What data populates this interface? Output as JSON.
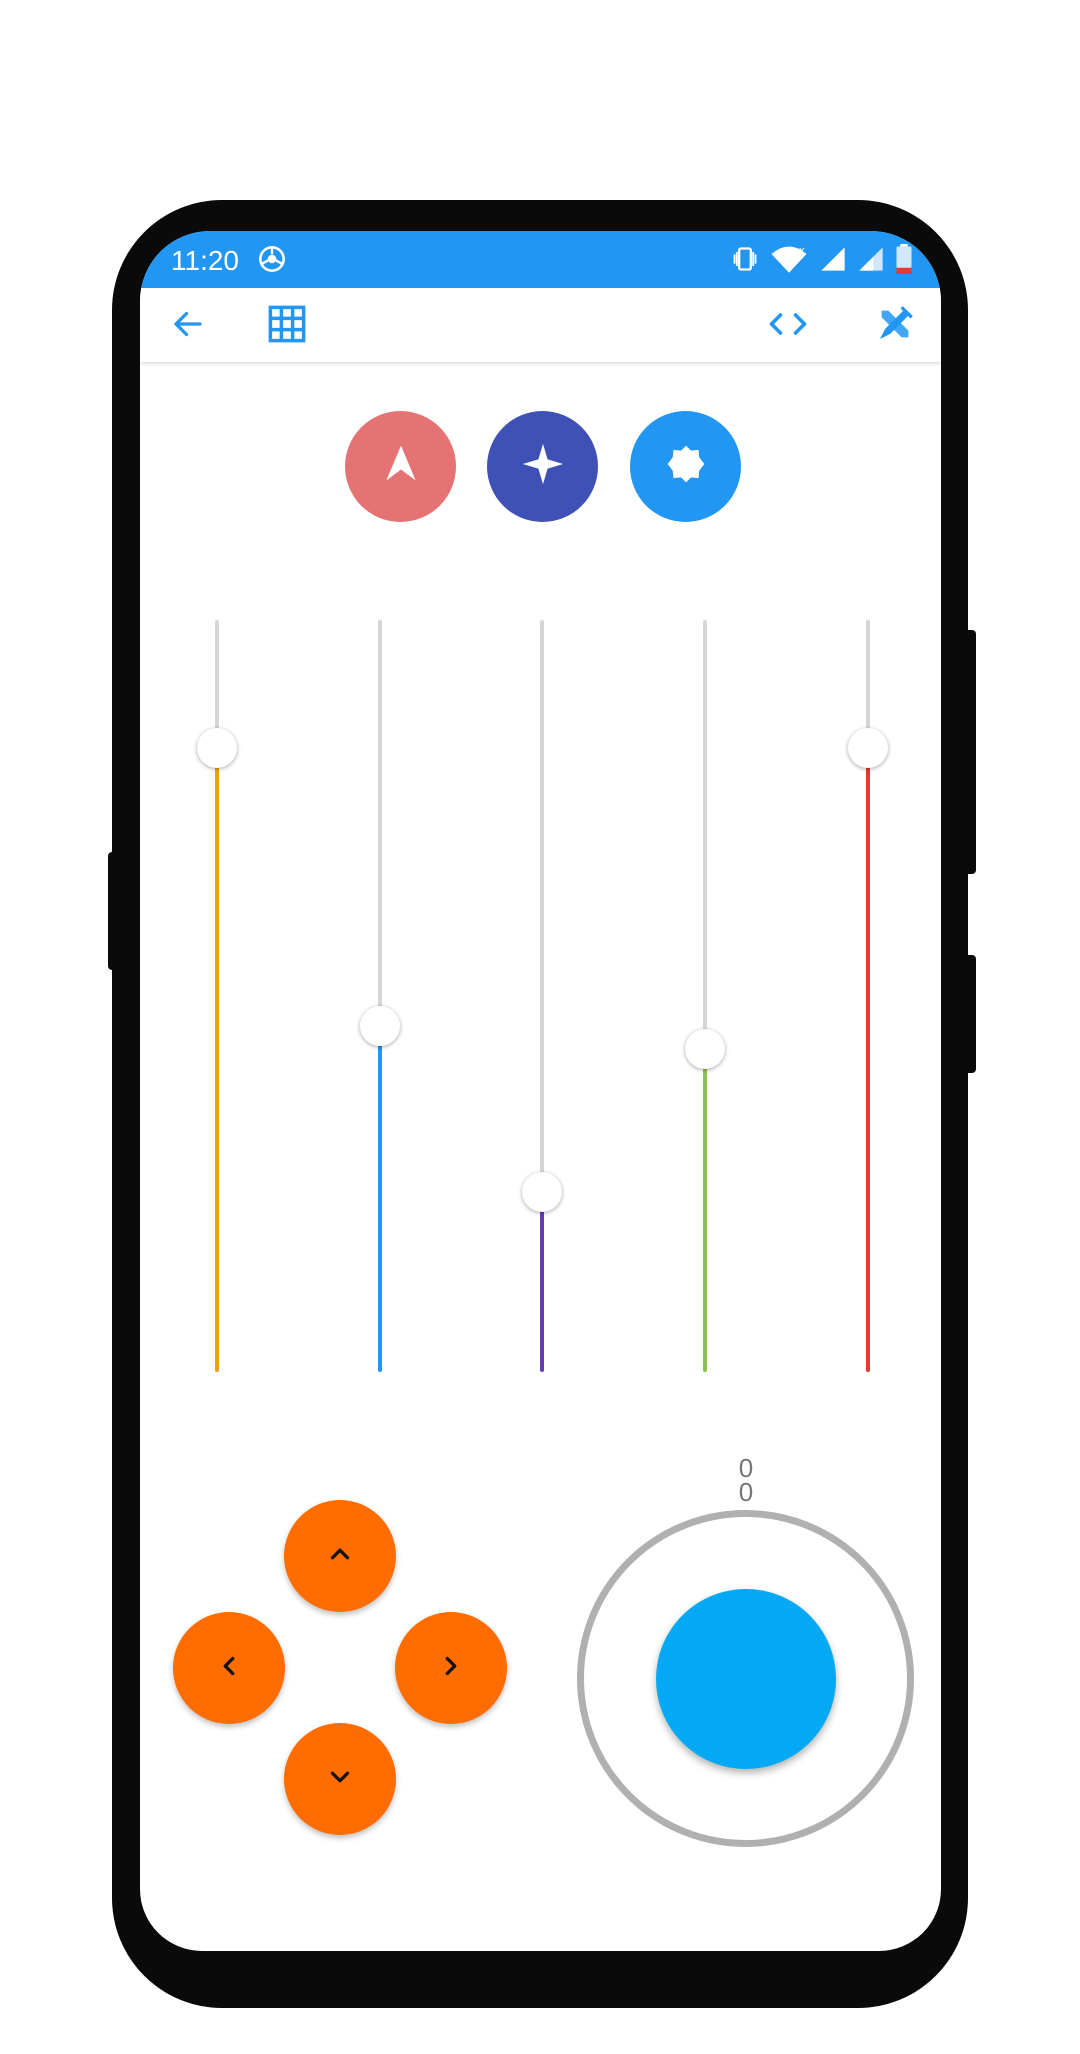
{
  "status_bar": {
    "time": "11:20",
    "icons": [
      "chrome-icon",
      "vibrate-icon",
      "wifi-icon",
      "signal-icon",
      "signal-icon",
      "battery-low-icon"
    ]
  },
  "app_bar": {
    "icons": [
      "back-arrow-icon",
      "grid-icon",
      "code-icon",
      "design-tools-icon"
    ],
    "accent_color": "#2196f3"
  },
  "action_buttons": [
    {
      "name": "navigation",
      "icon": "navigation-arrow-icon",
      "color": "#e57373"
    },
    {
      "name": "sparkle",
      "icon": "sparkle-icon",
      "color": "#3f51b5"
    },
    {
      "name": "badge",
      "icon": "badge-seal-icon",
      "color": "#2196f3"
    }
  ],
  "sliders": [
    {
      "color": "#f39c12",
      "value": 0.83
    },
    {
      "color": "#2196f3",
      "value": 0.46
    },
    {
      "color": "#673ab7",
      "value": 0.24
    },
    {
      "color": "#8bc34a",
      "value": 0.43
    },
    {
      "color": "#e53935",
      "value": 0.83
    }
  ],
  "dpad": {
    "color": "#ff6d00",
    "buttons": [
      "up",
      "left",
      "right",
      "down"
    ]
  },
  "joystick": {
    "x_value": "0",
    "y_value": "0",
    "ring_color": "#b0b0b0",
    "knob_color": "#03a9f4"
  }
}
